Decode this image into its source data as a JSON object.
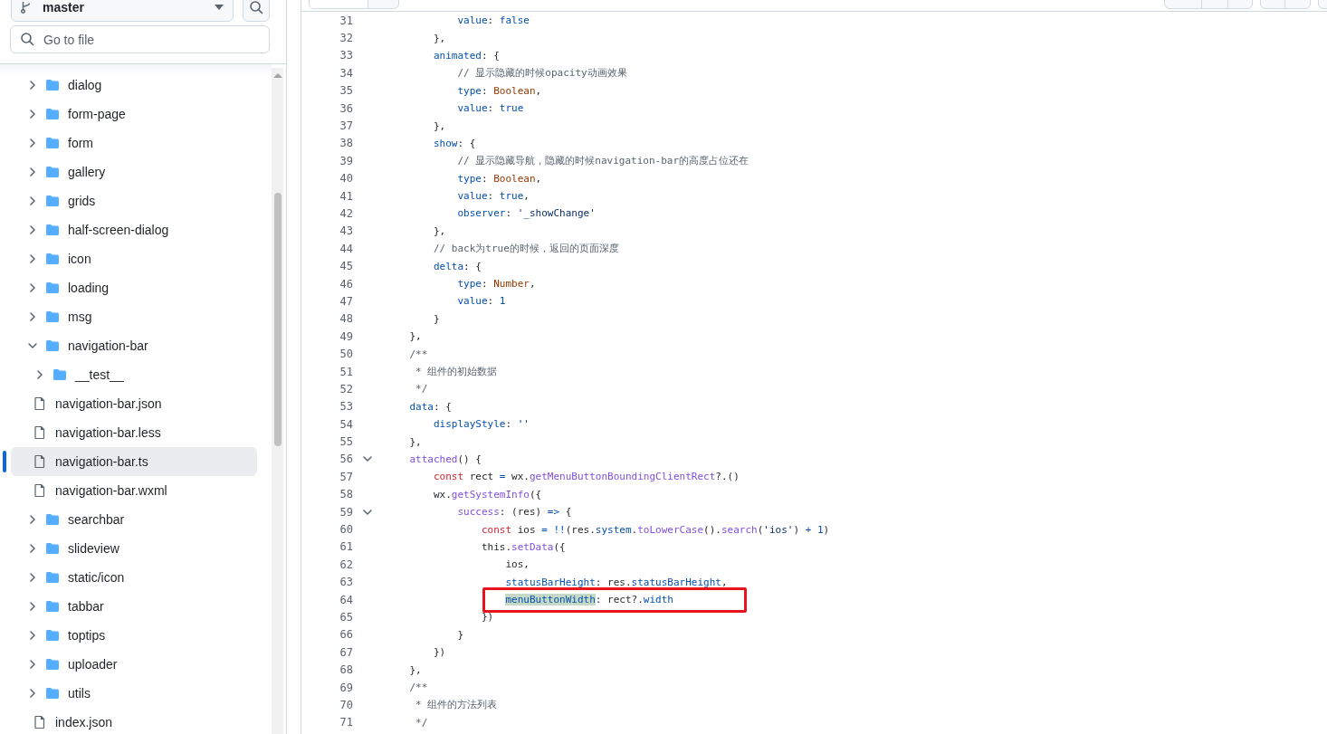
{
  "sidebar": {
    "branch": "master",
    "search": {
      "placeholder": "Go to file"
    },
    "tree": [
      {
        "kind": "folder",
        "name": "dialog",
        "expanded": false,
        "selected": false
      },
      {
        "kind": "folder",
        "name": "form-page",
        "expanded": false,
        "selected": false
      },
      {
        "kind": "folder",
        "name": "form",
        "expanded": false,
        "selected": false
      },
      {
        "kind": "folder",
        "name": "gallery",
        "expanded": false,
        "selected": false
      },
      {
        "kind": "folder",
        "name": "grids",
        "expanded": false,
        "selected": false
      },
      {
        "kind": "folder",
        "name": "half-screen-dialog",
        "expanded": false,
        "selected": false
      },
      {
        "kind": "folder",
        "name": "icon",
        "expanded": false,
        "selected": false
      },
      {
        "kind": "folder",
        "name": "loading",
        "expanded": false,
        "selected": false
      },
      {
        "kind": "folder",
        "name": "msg",
        "expanded": false,
        "selected": false
      },
      {
        "kind": "folder",
        "name": "navigation-bar",
        "expanded": true,
        "selected": false,
        "children": [
          {
            "kind": "folder",
            "name": "__test__",
            "expanded": false,
            "selected": false
          },
          {
            "kind": "file",
            "name": "navigation-bar.json",
            "selected": false
          },
          {
            "kind": "file",
            "name": "navigation-bar.less",
            "selected": false
          },
          {
            "kind": "file",
            "name": "navigation-bar.ts",
            "selected": true
          },
          {
            "kind": "file",
            "name": "navigation-bar.wxml",
            "selected": false
          }
        ]
      },
      {
        "kind": "folder",
        "name": "searchbar",
        "expanded": false,
        "selected": false
      },
      {
        "kind": "folder",
        "name": "slideview",
        "expanded": false,
        "selected": false
      },
      {
        "kind": "folder",
        "name": "static/icon",
        "expanded": false,
        "selected": false
      },
      {
        "kind": "folder",
        "name": "tabbar",
        "expanded": false,
        "selected": false
      },
      {
        "kind": "folder",
        "name": "toptips",
        "expanded": false,
        "selected": false
      },
      {
        "kind": "folder",
        "name": "uploader",
        "expanded": false,
        "selected": false
      },
      {
        "kind": "folder",
        "name": "utils",
        "expanded": false,
        "selected": false
      },
      {
        "kind": "file",
        "name": "index.json",
        "selected": false
      }
    ]
  },
  "code": {
    "lines": [
      {
        "number": "31",
        "tokens": [
          {
            "kind": "key",
            "text": "            value"
          },
          {
            "kind": "plain",
            "text": ": "
          },
          {
            "kind": "number",
            "text": "false"
          }
        ]
      },
      {
        "number": "32",
        "tokens": [
          {
            "kind": "plain",
            "text": "        },"
          }
        ]
      },
      {
        "number": "33",
        "tokens": [
          {
            "kind": "key",
            "text": "        animated"
          },
          {
            "kind": "plain",
            "text": ": {"
          }
        ]
      },
      {
        "number": "34",
        "tokens": [
          {
            "kind": "comment",
            "text": "            // 显示隐藏的时候opacity动画效果"
          }
        ]
      },
      {
        "number": "35",
        "tokens": [
          {
            "kind": "key",
            "text": "            type"
          },
          {
            "kind": "plain",
            "text": ": "
          },
          {
            "kind": "type",
            "text": "Boolean"
          },
          {
            "kind": "plain",
            "text": ","
          }
        ]
      },
      {
        "number": "36",
        "tokens": [
          {
            "kind": "key",
            "text": "            value"
          },
          {
            "kind": "plain",
            "text": ": "
          },
          {
            "kind": "number",
            "text": "true"
          }
        ]
      },
      {
        "number": "37",
        "tokens": [
          {
            "kind": "plain",
            "text": "        },"
          }
        ]
      },
      {
        "number": "38",
        "tokens": [
          {
            "kind": "key",
            "text": "        show"
          },
          {
            "kind": "plain",
            "text": ": {"
          }
        ]
      },
      {
        "number": "39",
        "tokens": [
          {
            "kind": "comment",
            "text": "            // 显示隐藏导航，隐藏的时候navigation-bar的高度占位还在"
          }
        ]
      },
      {
        "number": "40",
        "tokens": [
          {
            "kind": "key",
            "text": "            type"
          },
          {
            "kind": "plain",
            "text": ": "
          },
          {
            "kind": "type",
            "text": "Boolean"
          },
          {
            "kind": "plain",
            "text": ","
          }
        ]
      },
      {
        "number": "41",
        "tokens": [
          {
            "kind": "key",
            "text": "            value"
          },
          {
            "kind": "plain",
            "text": ": "
          },
          {
            "kind": "number",
            "text": "true"
          },
          {
            "kind": "plain",
            "text": ","
          }
        ]
      },
      {
        "number": "42",
        "tokens": [
          {
            "kind": "key",
            "text": "            observer"
          },
          {
            "kind": "plain",
            "text": ": "
          },
          {
            "kind": "string",
            "text": "'_showChange'"
          }
        ]
      },
      {
        "number": "43",
        "tokens": [
          {
            "kind": "plain",
            "text": "        },"
          }
        ]
      },
      {
        "number": "44",
        "tokens": [
          {
            "kind": "comment",
            "text": "        // back为true的时候，返回的页面深度"
          }
        ]
      },
      {
        "number": "45",
        "tokens": [
          {
            "kind": "key",
            "text": "        delta"
          },
          {
            "kind": "plain",
            "text": ": {"
          }
        ]
      },
      {
        "number": "46",
        "tokens": [
          {
            "kind": "key",
            "text": "            type"
          },
          {
            "kind": "plain",
            "text": ": "
          },
          {
            "kind": "type",
            "text": "Number"
          },
          {
            "kind": "plain",
            "text": ","
          }
        ]
      },
      {
        "number": "47",
        "tokens": [
          {
            "kind": "key",
            "text": "            value"
          },
          {
            "kind": "plain",
            "text": ": "
          },
          {
            "kind": "number",
            "text": "1"
          }
        ]
      },
      {
        "number": "48",
        "tokens": [
          {
            "kind": "plain",
            "text": "        }"
          }
        ]
      },
      {
        "number": "49",
        "tokens": [
          {
            "kind": "plain",
            "text": "    },"
          }
        ]
      },
      {
        "number": "50",
        "tokens": [
          {
            "kind": "comment",
            "text": "    /**"
          }
        ]
      },
      {
        "number": "51",
        "tokens": [
          {
            "kind": "comment",
            "text": "     * 组件的初始数据"
          }
        ]
      },
      {
        "number": "52",
        "tokens": [
          {
            "kind": "comment",
            "text": "     */"
          }
        ]
      },
      {
        "number": "53",
        "tokens": [
          {
            "kind": "key",
            "text": "    data"
          },
          {
            "kind": "plain",
            "text": ": {"
          }
        ]
      },
      {
        "number": "54",
        "tokens": [
          {
            "kind": "key",
            "text": "        displayStyle"
          },
          {
            "kind": "plain",
            "text": ": "
          },
          {
            "kind": "string",
            "text": "''"
          }
        ]
      },
      {
        "number": "55",
        "tokens": [
          {
            "kind": "plain",
            "text": "    },"
          }
        ]
      },
      {
        "number": "56",
        "fold": true,
        "tokens": [
          {
            "kind": "func",
            "text": "    attached"
          },
          {
            "kind": "plain",
            "text": "() {"
          }
        ]
      },
      {
        "number": "57",
        "tokens": [
          {
            "kind": "keyword",
            "text": "        const"
          },
          {
            "kind": "plain",
            "text": " rect "
          },
          {
            "kind": "key",
            "text": "="
          },
          {
            "kind": "plain",
            "text": " wx."
          },
          {
            "kind": "func",
            "text": "getMenuButtonBoundingClientRect"
          },
          {
            "kind": "plain",
            "text": "?.()"
          }
        ]
      },
      {
        "number": "58",
        "tokens": [
          {
            "kind": "plain",
            "text": "        wx."
          },
          {
            "kind": "func",
            "text": "getSystemInfo"
          },
          {
            "kind": "plain",
            "text": "({"
          }
        ]
      },
      {
        "number": "59",
        "fold": true,
        "tokens": [
          {
            "kind": "func",
            "text": "            success"
          },
          {
            "kind": "plain",
            "text": ": (res) "
          },
          {
            "kind": "key",
            "text": "=>"
          },
          {
            "kind": "plain",
            "text": " {"
          }
        ]
      },
      {
        "number": "60",
        "tokens": [
          {
            "kind": "keyword",
            "text": "                const"
          },
          {
            "kind": "plain",
            "text": " ios "
          },
          {
            "kind": "key",
            "text": "= !!"
          },
          {
            "kind": "plain",
            "text": "(res."
          },
          {
            "kind": "key",
            "text": "system"
          },
          {
            "kind": "plain",
            "text": "."
          },
          {
            "kind": "func",
            "text": "toLowerCase"
          },
          {
            "kind": "plain",
            "text": "()."
          },
          {
            "kind": "func",
            "text": "search"
          },
          {
            "kind": "plain",
            "text": "("
          },
          {
            "kind": "string",
            "text": "'ios'"
          },
          {
            "kind": "plain",
            "text": ") "
          },
          {
            "kind": "key",
            "text": "+"
          },
          {
            "kind": "number",
            "text": " 1"
          },
          {
            "kind": "plain",
            "text": ")"
          }
        ]
      },
      {
        "number": "61",
        "tokens": [
          {
            "kind": "plain",
            "text": "                this."
          },
          {
            "kind": "func",
            "text": "setData"
          },
          {
            "kind": "plain",
            "text": "({"
          }
        ]
      },
      {
        "number": "62",
        "tokens": [
          {
            "kind": "plain",
            "text": "                    ios,"
          }
        ]
      },
      {
        "number": "63",
        "tokens": [
          {
            "kind": "key",
            "text": "                    statusBarHeight"
          },
          {
            "kind": "plain",
            "text": ": res."
          },
          {
            "kind": "key",
            "text": "statusBarHeight"
          },
          {
            "kind": "plain",
            "text": ","
          }
        ]
      },
      {
        "number": "64",
        "annotated": true,
        "tokens": [
          {
            "kind": "key",
            "text": "                    menuButtonWidth",
            "highlighted": true
          },
          {
            "kind": "plain",
            "text": ": rect?."
          },
          {
            "kind": "key",
            "text": "width"
          }
        ]
      },
      {
        "number": "65",
        "tokens": [
          {
            "kind": "plain",
            "text": "                })"
          }
        ]
      },
      {
        "number": "66",
        "tokens": [
          {
            "kind": "plain",
            "text": "            }"
          }
        ]
      },
      {
        "number": "67",
        "tokens": [
          {
            "kind": "plain",
            "text": "        })"
          }
        ]
      },
      {
        "number": "68",
        "tokens": [
          {
            "kind": "plain",
            "text": "    },"
          }
        ]
      },
      {
        "number": "69",
        "tokens": [
          {
            "kind": "comment",
            "text": "    /**"
          }
        ]
      },
      {
        "number": "70",
        "tokens": [
          {
            "kind": "comment",
            "text": "     * 组件的方法列表"
          }
        ]
      },
      {
        "number": "71",
        "tokens": [
          {
            "kind": "comment",
            "text": "     */"
          }
        ]
      }
    ]
  }
}
